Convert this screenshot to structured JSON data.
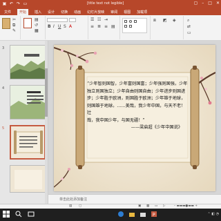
{
  "window": {
    "title": "[title text not legible]"
  },
  "ribbon_tabs": [
    "文件",
    "开始",
    "插入",
    "设计",
    "切换",
    "动画",
    "幻灯片放映",
    "审阅",
    "视图",
    "加载项"
  ],
  "slide_numbers": [
    "3",
    "4",
    "5"
  ],
  "poem": {
    "lines": [
      "“少年智则国智，少年富则国富；少年强则国强，少年",
      "独立则国独立；少年自由则国自由；少年进步则国进",
      "步；少年胜于欧洲，则国胜于欧洲；少年雄于地球，",
      "则国雄于地球。……美哉，我少年中国，与天不老！壮",
      "哉，我中国少年，与国无疆！”"
    ],
    "signature": "——梁启超《少年中国说》"
  },
  "notes_placeholder": "单击此处添加备注",
  "colors": {
    "accent": "#b7472a",
    "slide_bg": "#f1e8d8",
    "scroll": "#f6efdf",
    "branch": "#5a3a2a",
    "blossom": "#e9a3b3"
  }
}
